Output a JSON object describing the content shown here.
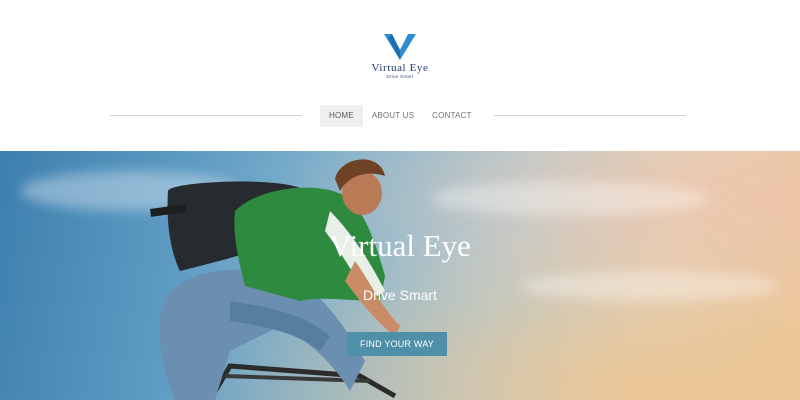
{
  "brand": {
    "name": "Virtual Eye",
    "tagline": "Drive Smart",
    "logo_icon": "v-chevron-logo",
    "accent_color": "#2e8ccf"
  },
  "nav": {
    "items": [
      {
        "label": "HOME",
        "active": true
      },
      {
        "label": "ABOUT US",
        "active": false
      },
      {
        "label": "CONTACT",
        "active": false
      }
    ]
  },
  "hero": {
    "title": "Virtual Eye",
    "subtitle": "Drive Smart",
    "button_label": "FIND YOUR WAY",
    "button_color": "#4f8fa8",
    "image": "cyclist-with-backpack-sky-photo"
  }
}
